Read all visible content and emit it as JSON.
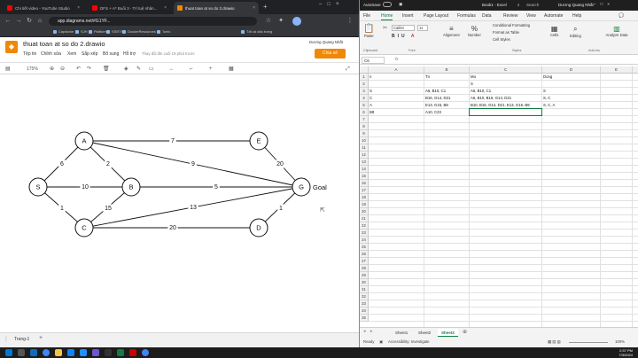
{
  "browser": {
    "tabs": [
      {
        "label": "Chi tiết video - YouTube Studio",
        "color": "#ff0000"
      },
      {
        "label": "DFS + A* Buổi 3 - Trí tuệ nhân...",
        "color": "#ff0000"
      },
      {
        "label": "thuat toan at so do 2.drawio",
        "color": "#f08705"
      }
    ],
    "url": "app.diagrams.net/#G1YF...",
    "bookmarks": [
      "Capstone",
      "SJH",
      "Platform",
      "SSBTS",
      "DockerResources",
      "Toeic",
      "Tất cả dấu trang"
    ]
  },
  "drawio": {
    "title": "thuat toan at so do 2.drawio",
    "menus": [
      "Tệp tin",
      "Chỉnh sửa",
      "Xem",
      "Sắp xếp",
      "Bổ sung",
      "Hỗ trợ"
    ],
    "saved_text": "Thay đổi lần cuối 19 phút trước",
    "user": "Dương Quang Nhất",
    "share_label": "Chia sẻ",
    "zoom": "175%",
    "page_tab": "Trang-1"
  },
  "graph": {
    "nodes": [
      {
        "id": "A",
        "label": "A"
      },
      {
        "id": "E",
        "label": "E"
      },
      {
        "id": "S",
        "label": "S"
      },
      {
        "id": "B",
        "label": "B"
      },
      {
        "id": "G",
        "label": "G"
      },
      {
        "id": "C",
        "label": "C"
      },
      {
        "id": "D",
        "label": "D"
      }
    ],
    "goal_label": "Goal",
    "edges": [
      {
        "from": "A",
        "to": "E",
        "weight": "7"
      },
      {
        "from": "A",
        "to": "G",
        "weight": "9"
      },
      {
        "from": "A",
        "to": "S",
        "weight": "6"
      },
      {
        "from": "A",
        "to": "B",
        "weight": "2"
      },
      {
        "from": "S",
        "to": "B",
        "weight": "10"
      },
      {
        "from": "S",
        "to": "C",
        "weight": "1"
      },
      {
        "from": "B",
        "to": "G",
        "weight": "5"
      },
      {
        "from": "B",
        "to": "C",
        "weight": "15"
      },
      {
        "from": "E",
        "to": "G",
        "weight": "20"
      },
      {
        "from": "C",
        "to": "G",
        "weight": "13"
      },
      {
        "from": "C",
        "to": "D",
        "weight": "20"
      },
      {
        "from": "D",
        "to": "G",
        "weight": "1"
      }
    ]
  },
  "excel": {
    "title": "Book1 - Excel",
    "autosave": "AutoSave",
    "user": "Dương Quang Nhất",
    "search": "Search",
    "menu": [
      "File",
      "Home",
      "Insert",
      "Page Layout",
      "Formulas",
      "Data",
      "Review",
      "View",
      "Automate",
      "Help"
    ],
    "ribbon": {
      "paste": "Paste",
      "font": "Calibri",
      "font_size": "11",
      "alignment": "Alignment",
      "number": "Number",
      "cond_format": "Conditional Formatting",
      "format_table": "Format as Table",
      "cell_styles": "Cell Styles",
      "cells": "Cells",
      "editing": "Editing",
      "analyze": "Analyze Data",
      "groups": [
        "Clipboard",
        "Font",
        "Styles",
        "Add-ins"
      ]
    },
    "namebox": "C6",
    "fx": "fx",
    "columns": [
      "A",
      "B",
      "C",
      "D",
      "E",
      "F"
    ],
    "rows": [
      [
        "n",
        "Tn",
        "Mo",
        "Dong"
      ],
      [
        "",
        "",
        "S",
        ""
      ],
      [
        "S",
        "A6, B10, C1",
        "A6, B10, C1",
        "S"
      ],
      [
        "C",
        "B16, G14, D21",
        "A6, B10, B16, G14, D21",
        "S, C"
      ],
      [
        "A",
        "E13, G15, B8",
        "B10, B16, G14, D21, E13, G15, B8",
        "S, C, A"
      ],
      [
        "B8",
        "A10, C23",
        "",
        ""
      ]
    ],
    "row_count": 35,
    "sheets": [
      "Sheet1",
      "Sheet2",
      "Sheet3"
    ],
    "active_sheet": "Sheet3",
    "status_ready": "Ready",
    "accessibility": "Accessibility: Investigate",
    "status_zoom": "100%"
  },
  "taskbar": {
    "time": "2:37 PM",
    "date": "7/3/2024"
  },
  "colors": {
    "excel_green": "#107c41",
    "drawio_orange": "#f08705"
  }
}
